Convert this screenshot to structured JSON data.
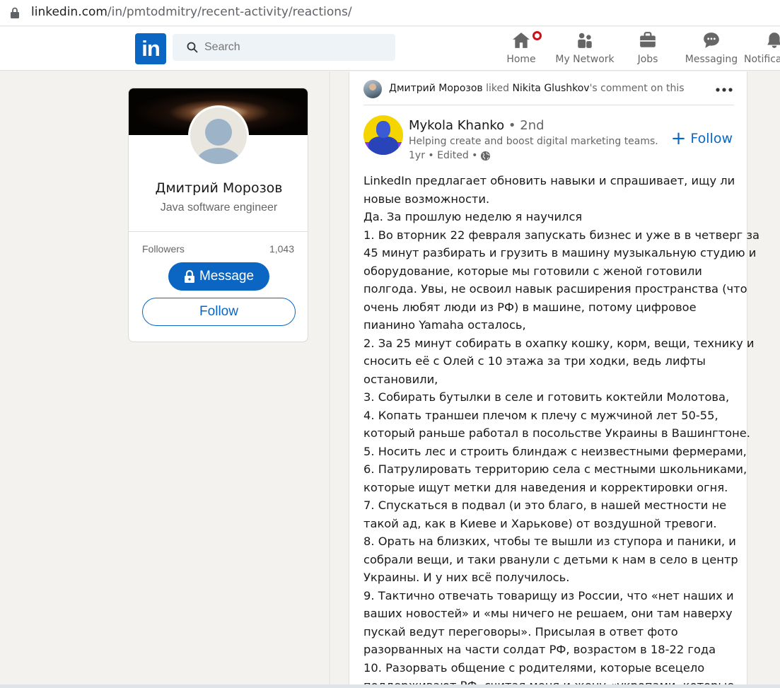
{
  "browser": {
    "url_host": "linkedin.com",
    "url_path": "/in/pmtodmitry/recent-activity/reactions/"
  },
  "navbar": {
    "logo_text": "in",
    "search_placeholder": "Search",
    "items": [
      {
        "label": "Home",
        "icon": "home-icon"
      },
      {
        "label": "My Network",
        "icon": "network-icon"
      },
      {
        "label": "Jobs",
        "icon": "jobs-icon"
      },
      {
        "label": "Messaging",
        "icon": "messaging-icon"
      },
      {
        "label": "Notifica",
        "icon": "bell-icon"
      }
    ]
  },
  "profile": {
    "name": "Дмитрий Морозов",
    "headline": "Java software engineer",
    "followers_label": "Followers",
    "followers_count": "1,043",
    "message_label": "Message",
    "follow_label": "Follow"
  },
  "activity": {
    "actor": "Дмитрий Морозов",
    "verb": " liked ",
    "target": "Nikita Glushkov",
    "suffix": "'s comment on this"
  },
  "post": {
    "author_name": "Mykola Khanko",
    "author_degree": " • 2nd",
    "author_headline": "Helping create and boost digital marketing teams.",
    "meta": "1yr • Edited •",
    "follow_label": "Follow",
    "lines": [
      "LinkedIn предлагает обновить навыки и спрашивает, ищу ли",
      "новые возможности.",
      "Да. За прошлую неделю я научился",
      "1. Во вторник 22 февраля запускать бизнес и уже в в четверг за",
      "45 минут разбирать и грузить в машину музыкальную студию и",
      "оборудование, которые мы готовили с женой готовили",
      "полгода. Увы, не освоил навык расширения пространства (что",
      "очень любят люди из РФ) в машине, потому цифровое",
      "пианино Yamaha осталось,",
      "2. За 25 минут собирать в охапку кошку, корм, вещи, технику и",
      "сносить её с Олей с 10 этажа за три ходки, ведь лифты",
      "остановили,",
      "3. Собирать бутылки в селе и готовить коктейли Молотова,",
      "4. Копать траншеи плечом к плечу с мужчиной лет 50-55,",
      "который раньше работал в посольстве Украины в Вашингтоне.",
      "5. Носить лес и строить блиндаж с неизвестными фермерами,",
      "6. Патрулировать территорию села с местными школьниками,",
      "которые ищут метки для наведения и корректировки огня.",
      "7. Спускаться в подвал (и это благо, в нашей местности не",
      "такой ад, как в Киеве и Харькове) от воздушной тревоги.",
      "8. Орать на близких, чтобы те вышли из ступора и паники, и",
      "собрали вещи, и таки рванули с детьми к нам в село в центр",
      "Украины. И у них всё получилось.",
      "9. Тактично отвечать товарищу из России, что «нет наших и",
      "ваших новостей» и «мы ничего не решаем, они там наверху",
      "пускай ведут переговоры». Присылая в ответ фото",
      "разорванных на части солдат РФ, возрастом в 18-22 года",
      "10. Разорвать общение с родителями, которые всецело",
      "поддерживают РФ, считая меня и жену «укропами, которые"
    ]
  },
  "colors": {
    "brand": "#0a66c2",
    "page_bg": "#f3f2ef",
    "badge": "#cc1016"
  }
}
